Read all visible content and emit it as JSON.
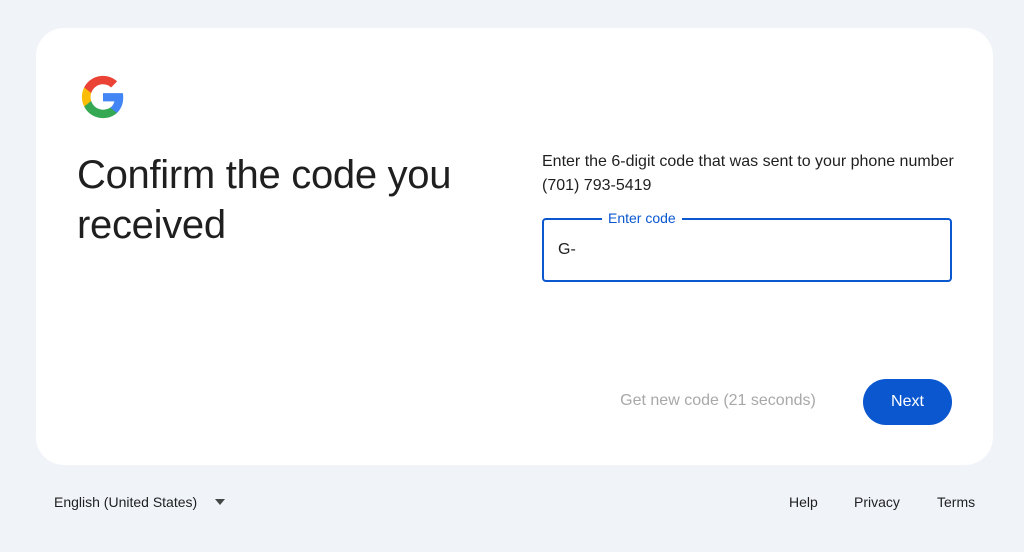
{
  "logo": {
    "icon": "google-g-logo-icon"
  },
  "heading": {
    "title": "Confirm the code you received"
  },
  "instructions": {
    "text": "Enter the 6-digit code that was sent to your phone number (701) 793-5419"
  },
  "code_field": {
    "label": "Enter code",
    "value": "G-"
  },
  "actions": {
    "resend_label": "Get new code (21 seconds)",
    "next_label": "Next"
  },
  "footer": {
    "language": "English (United States)",
    "language_icon": "caret-down-icon",
    "links": [
      "Help",
      "Privacy",
      "Terms"
    ]
  },
  "colors": {
    "page_background": "#f0f4f9",
    "card_background": "#ffffff",
    "accent": "#0b57d0",
    "disabled_text": "#a8a8a8",
    "google_blue": "#4285F4",
    "google_red": "#EA4335",
    "google_yellow": "#FBBC05",
    "google_green": "#34A853"
  }
}
